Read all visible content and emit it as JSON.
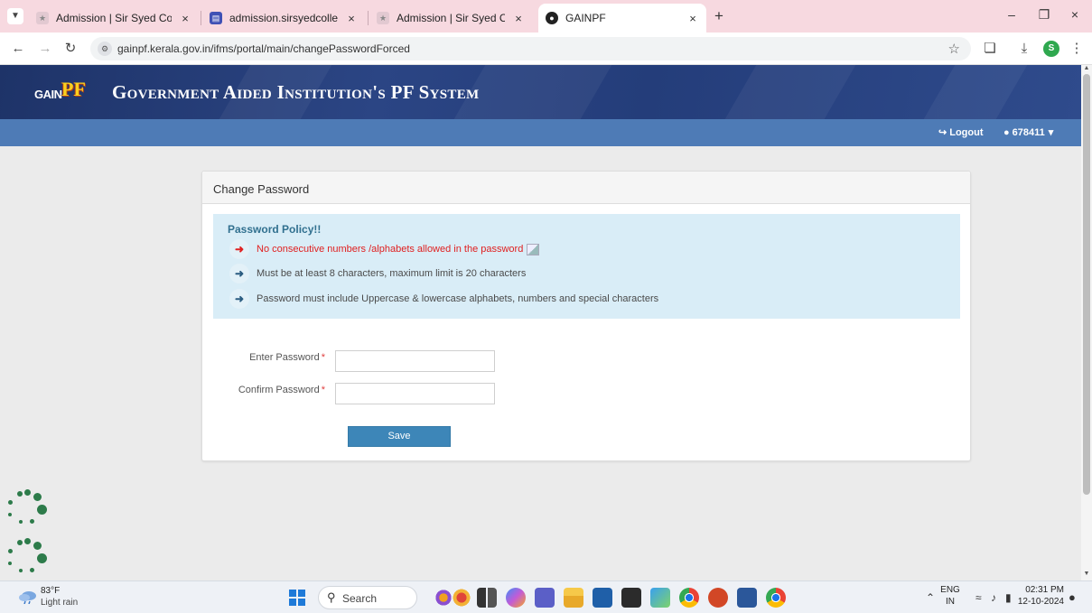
{
  "browser": {
    "tabs": [
      {
        "title": "Admission | Sir Syed College",
        "active": false
      },
      {
        "title": "admission.sirsyedcollege.ac.in",
        "active": false
      },
      {
        "title": "Admission | Sir Syed College",
        "active": false
      },
      {
        "title": "GAINPF",
        "active": true
      }
    ],
    "url": "gainpf.kerala.gov.in/ifms/portal/main/changePasswordForced",
    "profile_initial": "S"
  },
  "site": {
    "logo_gain": "GAIN",
    "logo_pf": "PF",
    "title": "Government Aided Institution's PF System"
  },
  "nav": {
    "logout_label": "Logout",
    "user_id": "678411"
  },
  "card": {
    "title": "Change Password"
  },
  "policy": {
    "title": "Password Policy!!",
    "items": [
      "No consecutive numbers /alphabets allowed in the password",
      "Must be at least 8 characters, maximum limit is 20 characters",
      "Password must include Uppercase & lowercase alphabets, numbers and special characters"
    ]
  },
  "form": {
    "enter_password_label": "Enter Password",
    "confirm_password_label": "Confirm Password",
    "required_mark": "*",
    "enter_password_value": "",
    "confirm_password_value": "",
    "save_label": "Save"
  },
  "taskbar": {
    "weather_temp": "83°F",
    "weather_desc": "Light rain",
    "search_label": "Search",
    "language": "ENG",
    "region": "IN",
    "time": "02:31 PM",
    "date": "12-10-2024"
  },
  "colors": {
    "header": "#243d7a",
    "nav_band": "#4e7bb6",
    "policy_bg": "#d9edf7",
    "save_button": "#3d86b8",
    "warning_text": "#e02020"
  }
}
